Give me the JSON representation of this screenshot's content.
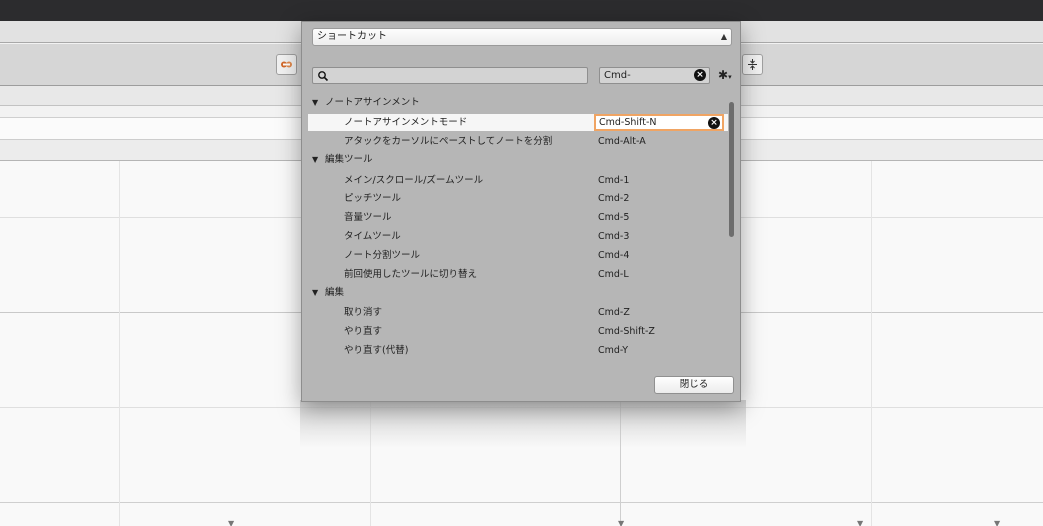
{
  "toolbar": {
    "left_button_icon": "link-icon",
    "right_button_icon": "collapse-icon"
  },
  "dialog": {
    "category_select": {
      "value": "ショートカット"
    },
    "search": {
      "value": ""
    },
    "filter": {
      "value": "Cmd-"
    },
    "settings_icon": "gear-icon",
    "groups": [
      {
        "label": "ノートアサインメント",
        "items": [
          {
            "name": "ノートアサインメントモード",
            "key": "Cmd-Shift-N",
            "selected": true
          },
          {
            "name": "アタックをカーソルにペーストしてノートを分割",
            "key": "Cmd-Alt-A"
          }
        ]
      },
      {
        "label": "編集ツール",
        "items": [
          {
            "name": "メイン/スクロール/ズームツール",
            "key": "Cmd-1"
          },
          {
            "name": "ピッチツール",
            "key": "Cmd-2"
          },
          {
            "name": "音量ツール",
            "key": "Cmd-5"
          },
          {
            "name": "タイムツール",
            "key": "Cmd-3"
          },
          {
            "name": "ノート分割ツール",
            "key": "Cmd-4"
          },
          {
            "name": "前回使用したツールに切り替え",
            "key": "Cmd-L"
          }
        ]
      },
      {
        "label": "編集",
        "items": [
          {
            "name": "取り消す",
            "key": "Cmd-Z"
          },
          {
            "name": "やり直す",
            "key": "Cmd-Shift-Z"
          },
          {
            "name": "やり直す(代替)",
            "key": "Cmd-Y"
          }
        ]
      }
    ],
    "close_label": "閉じる"
  }
}
